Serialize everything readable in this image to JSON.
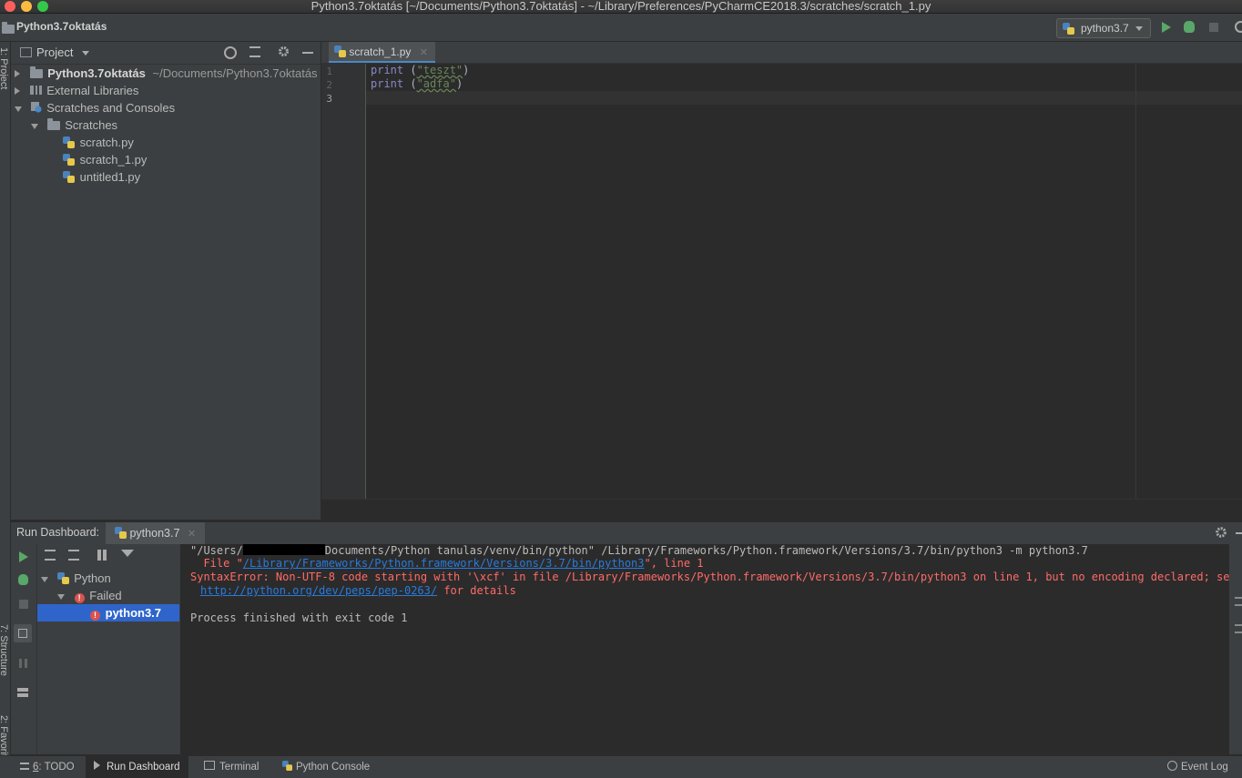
{
  "window": {
    "title": "Python3.7oktatás [~/Documents/Python3.7oktatás] - ~/Library/Preferences/PyCharmCE2018.3/scratches/scratch_1.py"
  },
  "navbar": {
    "project_name": "Python3.7oktatás",
    "run_config": "python3.7"
  },
  "left_stripe": {
    "project_label": "1: Project",
    "structure_label": "7: Structure",
    "favorites_label": "2: Favorites"
  },
  "project_panel": {
    "title": "Project",
    "tree": {
      "root_name": "Python3.7oktatás",
      "root_path": "~/Documents/Python3.7oktatás",
      "external_libraries": "External Libraries",
      "scratches_and_consoles": "Scratches and Consoles",
      "scratches_folder": "Scratches",
      "files": [
        "scratch.py",
        "scratch_1.py",
        "untitled1.py"
      ]
    }
  },
  "editor": {
    "tab_label": "scratch_1.py",
    "line_numbers": [
      "1",
      "2",
      "3"
    ],
    "lines": [
      {
        "kw": "print",
        "open": " (",
        "str": "\"teszt\"",
        "close": ")"
      },
      {
        "kw": "print",
        "open": " (",
        "str": "\"adfa\"",
        "close": ")"
      }
    ]
  },
  "run_dashboard": {
    "title": "Run Dashboard:",
    "tab_label": "python3.7",
    "tree": {
      "group": "Python",
      "status": "Failed",
      "config": "python3.7"
    },
    "console": {
      "line1_prefix": "\"/Users/",
      "line1_suffix": "Documents/Python tanulas/venv/bin/python\" /Library/Frameworks/Python.framework/Versions/3.7/bin/python3 -m python3.7",
      "line2_prefix": "  File \"",
      "line2_link": "/Library/Frameworks/Python.framework/Versions/3.7/bin/python3",
      "line2_suffix": "\", line 1",
      "line3": "SyntaxError: Non-UTF-8 code starting with '\\xcf' in file /Library/Frameworks/Python.framework/Versions/3.7/bin/python3 on line 1, but no encoding declared; see",
      "line4_link": "http://python.org/dev/peps/pep-0263/",
      "line4_suffix": " for details",
      "line5": "Process finished with exit code 1"
    }
  },
  "statusbar": {
    "todo_num": "6",
    "todo_label": ": TODO",
    "run_dashboard": "Run Dashboard",
    "terminal": "Terminal",
    "python_console": "Python Console",
    "event_log": "Event Log"
  },
  "colors": {
    "keyword": "#8888c6",
    "string": "#6a8759",
    "error": "#ff6b68",
    "link": "#287bde",
    "selection": "#2f65ca",
    "run_green": "#59a869"
  }
}
